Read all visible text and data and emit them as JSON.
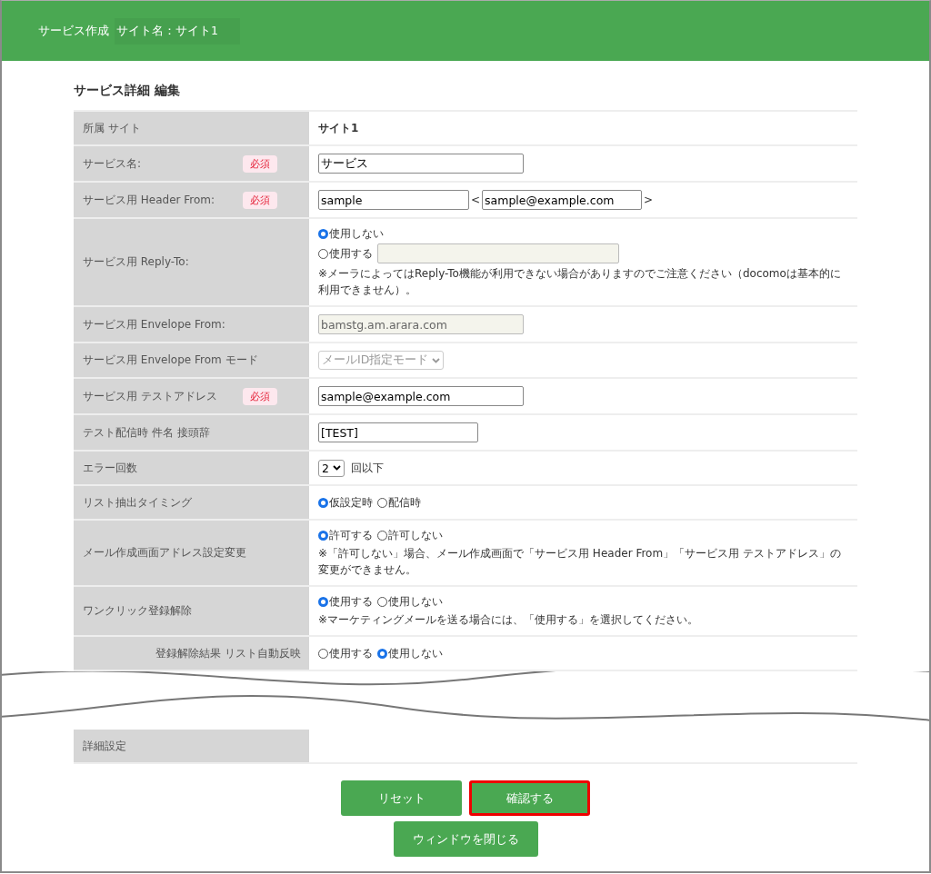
{
  "header": {
    "title": "サービス作成",
    "site": "サイト名：サイト1"
  },
  "section_title": "サービス詳細 編集",
  "rows": [
    {
      "label": "所属 サイト",
      "required": false,
      "cells": [
        {
          "kind": "text",
          "text": "サイト1",
          "bold": true
        }
      ]
    },
    {
      "label": "サービス名:",
      "required": true,
      "badge": "必須",
      "cells": [
        {
          "kind": "input",
          "value": "サービス",
          "disabled": false
        }
      ]
    },
    {
      "label": "サービス用 Header From:",
      "required": true,
      "badge": "必須",
      "cells": [
        {
          "kind": "input",
          "value": "sample",
          "disabled": false
        },
        {
          "kind": "text",
          "text": "<"
        },
        {
          "kind": "input",
          "value": "sample@example.com",
          "disabled": false
        },
        {
          "kind": "text",
          "text": ">"
        }
      ]
    },
    {
      "label": "サービス用 Reply-To:",
      "required": false,
      "cells": [
        {
          "kind": "radios",
          "stacked": true,
          "options": [
            {
              "label": "使用しない",
              "selected": true
            },
            {
              "label": "使用する",
              "selected": false,
              "field": {
                "disabled": true
              }
            }
          ]
        },
        {
          "kind": "note",
          "text": "※メーラによってはReply-To機能が利用できない場合がありますのでご注意ください（docomoは基本的に利用できません）。"
        }
      ]
    },
    {
      "label": "サービス用 Envelope From:",
      "required": false,
      "cells": [
        {
          "kind": "input",
          "value": "bamstg.am.arara.com",
          "disabled": true
        }
      ]
    },
    {
      "label": "サービス用 Envelope From モード",
      "required": false,
      "cells": [
        {
          "kind": "select",
          "value": "メールID指定モード",
          "disabled": true
        }
      ]
    },
    {
      "label": "サービス用 テストアドレス",
      "required": true,
      "badge": "必須",
      "cells": [
        {
          "kind": "input",
          "value": "sample@example.com",
          "disabled": false
        }
      ]
    },
    {
      "label": "テスト配信時 件名 接頭辞",
      "required": false,
      "cells": [
        {
          "kind": "input",
          "value": "[TEST]",
          "disabled": false
        }
      ]
    },
    {
      "label": "エラー回数",
      "required": false,
      "cells": [
        {
          "kind": "select",
          "value": "2",
          "disabled": false
        },
        {
          "kind": "text",
          "text": "回以下"
        }
      ]
    },
    {
      "label": "リスト抽出タイミング",
      "required": false,
      "cells": [
        {
          "kind": "radios",
          "stacked": false,
          "options": [
            {
              "label": "仮設定時",
              "selected": true
            },
            {
              "label": "配信時",
              "selected": false
            }
          ]
        }
      ]
    },
    {
      "label": "メール作成画面アドレス設定変更",
      "required": false,
      "cells": [
        {
          "kind": "radios",
          "stacked": false,
          "options": [
            {
              "label": "許可する",
              "selected": true
            },
            {
              "label": "許可しない",
              "selected": false
            }
          ]
        },
        {
          "kind": "note",
          "text": "※「許可しない」場合、メール作成画面で「サービス用 Header From」「サービス用 テストアドレス」の変更ができません。"
        }
      ]
    },
    {
      "label": "ワンクリック登録解除",
      "required": false,
      "cells": [
        {
          "kind": "radios",
          "stacked": false,
          "options": [
            {
              "label": "使用する",
              "selected": true
            },
            {
              "label": "使用しない",
              "selected": false
            }
          ]
        },
        {
          "kind": "note",
          "text": "※マーケティングメールを送る場合には、「使用する」を選択してください。"
        }
      ]
    },
    {
      "label": "登録解除結果 リスト自動反映",
      "required": false,
      "torn": true,
      "cells": [
        {
          "kind": "radios",
          "stacked": false,
          "options": [
            {
              "label": "使用する",
              "selected": false
            },
            {
              "label": "使用しない",
              "selected": true
            }
          ]
        }
      ]
    },
    {
      "label": "詳細設定",
      "required": false,
      "cells": []
    }
  ],
  "buttons": [
    {
      "label": "リセット",
      "highlighted": false
    },
    {
      "label": "確認する",
      "highlighted": true
    },
    {
      "label": "ウィンドウを閉じる",
      "highlighted": false
    }
  ]
}
